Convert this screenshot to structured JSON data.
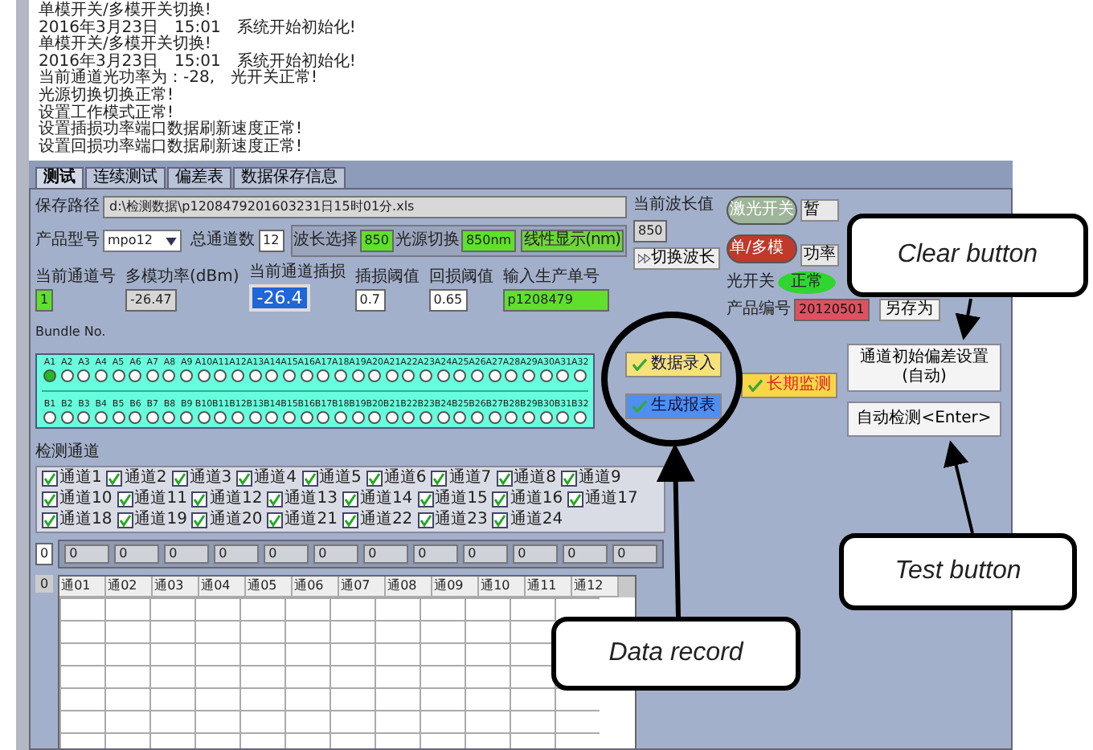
{
  "log": [
    "单模开关/多模开关切换!",
    "2016年3月23日　15:01　系统开始初始化!",
    "单模开关/多模开关切换!",
    "2016年3月23日　15:01　系统开始初始化!",
    "当前通道光功率为：-28,　光开关正常!",
    "光源切换切换正常!",
    "设置工作模式正常!",
    "设置插损功率端口数据刷新速度正常!",
    "设置回损功率端口数据刷新速度正常!"
  ],
  "tabs": [
    {
      "label": "测试",
      "selected": true
    },
    {
      "label": "连续测试",
      "selected": false
    },
    {
      "label": "偏差表",
      "selected": false
    },
    {
      "label": "数据保存信息",
      "selected": false
    }
  ],
  "save_path": {
    "label": "保存路径",
    "value": "d:\\检测数据\\p1208479201603231日15时01分.xls"
  },
  "product_model": {
    "label": "产品型号",
    "value": "mpo12"
  },
  "total_channels": {
    "label": "总通道数",
    "value": "12"
  },
  "wavelength_select": {
    "label": "波长选择",
    "value": "850"
  },
  "light_source": {
    "label": "光源切换",
    "value": "850nm"
  },
  "linear_display": "线性显示(nm)",
  "current_wavelength": {
    "label": "当前波长值",
    "value": "850"
  },
  "switch_wavelength_button": "切换波长",
  "indicators": [
    {
      "label": "激光开关",
      "color": "#9fb59a"
    },
    {
      "label": "单/多模",
      "color": "#c0392b"
    }
  ],
  "partial_buttons": [
    "暂",
    "功率"
  ],
  "optical_switch": {
    "label": "光开关",
    "value": "正常",
    "on": true
  },
  "product_number": {
    "label": "产品编号",
    "value": "20120501"
  },
  "save_as_button": "另存为",
  "readouts": [
    {
      "label": "当前通道号",
      "value": "1",
      "kind": "spin-green"
    },
    {
      "label": "多模功率(dBm)",
      "value": "-26.47",
      "kind": "display"
    },
    {
      "label": "当前通道插损",
      "value": "-26.4",
      "kind": "big"
    },
    {
      "label": "插损阈值",
      "value": "0.7",
      "kind": "spin"
    },
    {
      "label": "回损阈值",
      "value": "0.65",
      "kind": "spin"
    },
    {
      "label": "输入生产单号",
      "value": "p1208479",
      "kind": "green"
    }
  ],
  "bundle": {
    "label": "Bundle No.",
    "row_a": [
      {
        "label": "A1",
        "on": true
      },
      {
        "label": "A2",
        "on": false
      },
      {
        "label": "A3",
        "on": false
      },
      {
        "label": "A4",
        "on": false
      },
      {
        "label": "A5",
        "on": false
      },
      {
        "label": "A6",
        "on": false
      },
      {
        "label": "A7",
        "on": false
      },
      {
        "label": "A8",
        "on": false
      },
      {
        "label": "A9",
        "on": false
      },
      {
        "label": "A10",
        "on": false
      },
      {
        "label": "A11",
        "on": false
      },
      {
        "label": "A12",
        "on": false
      },
      {
        "label": "A13",
        "on": false
      },
      {
        "label": "A14",
        "on": false
      },
      {
        "label": "A15",
        "on": false
      },
      {
        "label": "A16",
        "on": false
      },
      {
        "label": "A17",
        "on": false
      },
      {
        "label": "A18",
        "on": false
      },
      {
        "label": "A19",
        "on": false
      },
      {
        "label": "A20",
        "on": false
      },
      {
        "label": "A21",
        "on": false
      },
      {
        "label": "A22",
        "on": false
      },
      {
        "label": "A23",
        "on": false
      },
      {
        "label": "A24",
        "on": false
      },
      {
        "label": "A25",
        "on": false
      },
      {
        "label": "A26",
        "on": false
      },
      {
        "label": "A27",
        "on": false
      },
      {
        "label": "A28",
        "on": false
      },
      {
        "label": "A29",
        "on": false
      },
      {
        "label": "A30",
        "on": false
      },
      {
        "label": "A31",
        "on": false
      },
      {
        "label": "A32",
        "on": false
      }
    ],
    "row_b": [
      {
        "label": "B1",
        "on": false
      },
      {
        "label": "B2",
        "on": false
      },
      {
        "label": "B3",
        "on": false
      },
      {
        "label": "B4",
        "on": false
      },
      {
        "label": "B5",
        "on": false
      },
      {
        "label": "B6",
        "on": false
      },
      {
        "label": "B7",
        "on": false
      },
      {
        "label": "B8",
        "on": false
      },
      {
        "label": "B9",
        "on": false
      },
      {
        "label": "B10",
        "on": false
      },
      {
        "label": "B11",
        "on": false
      },
      {
        "label": "B12",
        "on": false
      },
      {
        "label": "B13",
        "on": false
      },
      {
        "label": "B14",
        "on": false
      },
      {
        "label": "B15",
        "on": false
      },
      {
        "label": "B16",
        "on": false
      },
      {
        "label": "B17",
        "on": false
      },
      {
        "label": "B18",
        "on": false
      },
      {
        "label": "B19",
        "on": false
      },
      {
        "label": "B20",
        "on": false
      },
      {
        "label": "B21",
        "on": false
      },
      {
        "label": "B22",
        "on": false
      },
      {
        "label": "B23",
        "on": false
      },
      {
        "label": "B24",
        "on": false
      },
      {
        "label": "B25",
        "on": false
      },
      {
        "label": "B26",
        "on": false
      },
      {
        "label": "B27",
        "on": false
      },
      {
        "label": "B28",
        "on": false
      },
      {
        "label": "B29",
        "on": false
      },
      {
        "label": "B30",
        "on": false
      },
      {
        "label": "B31",
        "on": false
      },
      {
        "label": "B32",
        "on": false
      }
    ]
  },
  "action_buttons": [
    {
      "label": "数据录入",
      "color": "#f7e27a"
    },
    {
      "label": "生成报表",
      "color": "#4f8ff0"
    },
    {
      "label": "长期监测",
      "color": "#f9d54a"
    }
  ],
  "channel_init_button": "通道初始偏差设置(自动)",
  "auto_test_button": "自动检测<Enter>",
  "detect_channels": {
    "label": "检测通道",
    "items": [
      {
        "label": "通道1",
        "checked": true
      },
      {
        "label": "通道2",
        "checked": true
      },
      {
        "label": "通道3",
        "checked": true
      },
      {
        "label": "通道4",
        "checked": true
      },
      {
        "label": "通道5",
        "checked": true
      },
      {
        "label": "通道6",
        "checked": true
      },
      {
        "label": "通道7",
        "checked": true
      },
      {
        "label": "通道8",
        "checked": true
      },
      {
        "label": "通道9",
        "checked": true
      },
      {
        "label": "通道10",
        "checked": true
      },
      {
        "label": "通道11",
        "checked": true
      },
      {
        "label": "通道12",
        "checked": true
      },
      {
        "label": "通道13",
        "checked": true
      },
      {
        "label": "通道14",
        "checked": true
      },
      {
        "label": "通道15",
        "checked": true
      },
      {
        "label": "通道16",
        "checked": true
      },
      {
        "label": "通道17",
        "checked": true
      },
      {
        "label": "通道18",
        "checked": true
      },
      {
        "label": "通道19",
        "checked": true
      },
      {
        "label": "通道20",
        "checked": true
      },
      {
        "label": "通道21",
        "checked": true
      },
      {
        "label": "通道22",
        "checked": true
      },
      {
        "label": "通道23",
        "checked": true
      },
      {
        "label": "通道24",
        "checked": true
      }
    ]
  },
  "array": {
    "index": "0",
    "values": [
      "0",
      "0",
      "0",
      "0",
      "0",
      "0",
      "0",
      "0",
      "0",
      "0",
      "0",
      "0"
    ]
  },
  "table": {
    "index": "0",
    "columns": [
      "通01",
      "通02",
      "通03",
      "通04",
      "通05",
      "通06",
      "通07",
      "通08",
      "通09",
      "通10",
      "通11",
      "通12"
    ]
  },
  "annotations": [
    {
      "kind": "clear",
      "text": "Clear button"
    },
    {
      "kind": "record",
      "text": "Data record"
    },
    {
      "kind": "test",
      "text": "Test button"
    }
  ]
}
